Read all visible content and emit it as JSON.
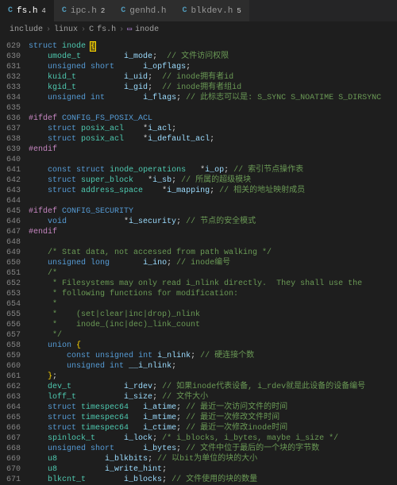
{
  "tabs": [
    {
      "icon": "C",
      "label": "fs.h",
      "mod": "4",
      "active": true
    },
    {
      "icon": "C",
      "label": "ipc.h",
      "mod": "2",
      "active": false
    },
    {
      "icon": "C",
      "label": "genhd.h",
      "mod": "",
      "active": false
    },
    {
      "icon": "C",
      "label": "blkdev.h",
      "mod": "5",
      "active": false
    }
  ],
  "breadcrumb": {
    "parts": [
      "include",
      "linux",
      "fs.h"
    ],
    "symbol": "inode"
  },
  "lines": [
    {
      "n": "",
      "tokens": []
    },
    {
      "n": "629",
      "tokens": [
        [
          "kw",
          "struct"
        ],
        [
          "plain",
          " "
        ],
        [
          "typename",
          "inode"
        ],
        [
          "plain",
          " "
        ],
        [
          "punc cursor",
          "{"
        ]
      ]
    },
    {
      "n": "630",
      "tokens": [
        [
          "plain",
          "    "
        ],
        [
          "typename",
          "umode_t"
        ],
        [
          "plain",
          "         "
        ],
        [
          "ident",
          "i_mode"
        ],
        [
          "plain",
          ";  "
        ],
        [
          "comment",
          "// 文件访问权限"
        ]
      ]
    },
    {
      "n": "631",
      "tokens": [
        [
          "plain",
          "    "
        ],
        [
          "kw",
          "unsigned"
        ],
        [
          "plain",
          " "
        ],
        [
          "kw",
          "short"
        ],
        [
          "plain",
          "      "
        ],
        [
          "ident",
          "i_opflags"
        ],
        [
          "plain",
          ";"
        ]
      ]
    },
    {
      "n": "632",
      "tokens": [
        [
          "plain",
          "    "
        ],
        [
          "typename",
          "kuid_t"
        ],
        [
          "plain",
          "          "
        ],
        [
          "ident",
          "i_uid"
        ],
        [
          "plain",
          ";  "
        ],
        [
          "comment",
          "// inode拥有者id"
        ]
      ]
    },
    {
      "n": "633",
      "tokens": [
        [
          "plain",
          "    "
        ],
        [
          "typename",
          "kgid_t"
        ],
        [
          "plain",
          "          "
        ],
        [
          "ident",
          "i_gid"
        ],
        [
          "plain",
          ";  "
        ],
        [
          "comment",
          "// inode拥有者组id"
        ]
      ]
    },
    {
      "n": "634",
      "tokens": [
        [
          "plain",
          "    "
        ],
        [
          "kw",
          "unsigned"
        ],
        [
          "plain",
          " "
        ],
        [
          "kw",
          "int"
        ],
        [
          "plain",
          "        "
        ],
        [
          "ident",
          "i_flags"
        ],
        [
          "plain",
          "; "
        ],
        [
          "comment",
          "// 此标志可以是: S_SYNC S_NOATIME S_DIRSYNC"
        ]
      ]
    },
    {
      "n": "635",
      "tokens": []
    },
    {
      "n": "636",
      "tokens": [
        [
          "macro",
          "#ifdef"
        ],
        [
          "plain",
          " "
        ],
        [
          "define",
          "CONFIG_FS_POSIX_ACL"
        ]
      ]
    },
    {
      "n": "637",
      "tokens": [
        [
          "plain",
          "    "
        ],
        [
          "kw",
          "struct"
        ],
        [
          "plain",
          " "
        ],
        [
          "typename",
          "posix_acl"
        ],
        [
          "plain",
          "    *"
        ],
        [
          "ident",
          "i_acl"
        ],
        [
          "plain",
          ";"
        ]
      ]
    },
    {
      "n": "638",
      "tokens": [
        [
          "plain",
          "    "
        ],
        [
          "kw",
          "struct"
        ],
        [
          "plain",
          " "
        ],
        [
          "typename",
          "posix_acl"
        ],
        [
          "plain",
          "    *"
        ],
        [
          "ident",
          "i_default_acl"
        ],
        [
          "plain",
          ";"
        ]
      ]
    },
    {
      "n": "639",
      "tokens": [
        [
          "macro",
          "#endif"
        ]
      ]
    },
    {
      "n": "640",
      "tokens": []
    },
    {
      "n": "641",
      "tokens": [
        [
          "plain",
          "    "
        ],
        [
          "kw",
          "const"
        ],
        [
          "plain",
          " "
        ],
        [
          "kw",
          "struct"
        ],
        [
          "plain",
          " "
        ],
        [
          "typename",
          "inode_operations"
        ],
        [
          "plain",
          "   *"
        ],
        [
          "ident",
          "i_op"
        ],
        [
          "plain",
          "; "
        ],
        [
          "comment",
          "// 索引节点操作表"
        ]
      ]
    },
    {
      "n": "642",
      "tokens": [
        [
          "plain",
          "    "
        ],
        [
          "kw",
          "struct"
        ],
        [
          "plain",
          " "
        ],
        [
          "typename",
          "super_block"
        ],
        [
          "plain",
          "   *"
        ],
        [
          "ident",
          "i_sb"
        ],
        [
          "plain",
          "; "
        ],
        [
          "comment",
          "// 所属的超级模块"
        ]
      ]
    },
    {
      "n": "643",
      "tokens": [
        [
          "plain",
          "    "
        ],
        [
          "kw",
          "struct"
        ],
        [
          "plain",
          " "
        ],
        [
          "typename",
          "address_space"
        ],
        [
          "plain",
          "    *"
        ],
        [
          "ident",
          "i_mapping"
        ],
        [
          "plain",
          "; "
        ],
        [
          "comment",
          "// 相关的地址映射成员"
        ]
      ]
    },
    {
      "n": "644",
      "tokens": []
    },
    {
      "n": "645",
      "tokens": [
        [
          "macro",
          "#ifdef"
        ],
        [
          "plain",
          " "
        ],
        [
          "define",
          "CONFIG_SECURITY"
        ]
      ]
    },
    {
      "n": "646",
      "tokens": [
        [
          "plain",
          "    "
        ],
        [
          "kw",
          "void"
        ],
        [
          "plain",
          "            *"
        ],
        [
          "ident",
          "i_security"
        ],
        [
          "plain",
          "; "
        ],
        [
          "comment",
          "// 节点的安全模式"
        ]
      ]
    },
    {
      "n": "647",
      "tokens": [
        [
          "macro",
          "#endif"
        ]
      ]
    },
    {
      "n": "648",
      "tokens": []
    },
    {
      "n": "649",
      "tokens": [
        [
          "plain",
          "    "
        ],
        [
          "comment",
          "/* Stat data, not accessed from path walking */"
        ]
      ]
    },
    {
      "n": "650",
      "tokens": [
        [
          "plain",
          "    "
        ],
        [
          "kw",
          "unsigned"
        ],
        [
          "plain",
          " "
        ],
        [
          "kw",
          "long"
        ],
        [
          "plain",
          "       "
        ],
        [
          "ident",
          "i_ino"
        ],
        [
          "plain",
          "; "
        ],
        [
          "comment",
          "// inode编号"
        ]
      ]
    },
    {
      "n": "651",
      "tokens": [
        [
          "plain",
          "    "
        ],
        [
          "comment",
          "/*"
        ]
      ]
    },
    {
      "n": "652",
      "tokens": [
        [
          "plain",
          "    "
        ],
        [
          "comment",
          " * Filesystems may only read i_nlink directly.  They shall use the"
        ]
      ]
    },
    {
      "n": "653",
      "tokens": [
        [
          "plain",
          "    "
        ],
        [
          "comment",
          " * following functions for modification:"
        ]
      ]
    },
    {
      "n": "654",
      "tokens": [
        [
          "plain",
          "    "
        ],
        [
          "comment",
          " *"
        ]
      ]
    },
    {
      "n": "655",
      "tokens": [
        [
          "plain",
          "    "
        ],
        [
          "comment",
          " *    (set|clear|inc|drop)_nlink"
        ]
      ]
    },
    {
      "n": "656",
      "tokens": [
        [
          "plain",
          "    "
        ],
        [
          "comment",
          " *    inode_(inc|dec)_link_count"
        ]
      ]
    },
    {
      "n": "657",
      "tokens": [
        [
          "plain",
          "    "
        ],
        [
          "comment",
          " */"
        ]
      ]
    },
    {
      "n": "658",
      "tokens": [
        [
          "plain",
          "    "
        ],
        [
          "kw",
          "union"
        ],
        [
          "plain",
          " "
        ],
        [
          "punc",
          "{"
        ]
      ]
    },
    {
      "n": "659",
      "tokens": [
        [
          "plain",
          "        "
        ],
        [
          "kw",
          "const"
        ],
        [
          "plain",
          " "
        ],
        [
          "kw",
          "unsigned"
        ],
        [
          "plain",
          " "
        ],
        [
          "kw",
          "int"
        ],
        [
          "plain",
          " "
        ],
        [
          "ident",
          "i_nlink"
        ],
        [
          "plain",
          "; "
        ],
        [
          "comment",
          "// 硬连接个数"
        ]
      ]
    },
    {
      "n": "660",
      "tokens": [
        [
          "plain",
          "        "
        ],
        [
          "kw",
          "unsigned"
        ],
        [
          "plain",
          " "
        ],
        [
          "kw",
          "int"
        ],
        [
          "plain",
          " "
        ],
        [
          "ident",
          "__i_nlink"
        ],
        [
          "plain",
          ";"
        ]
      ]
    },
    {
      "n": "661",
      "tokens": [
        [
          "plain",
          "    "
        ],
        [
          "punc",
          "}"
        ],
        [
          "plain",
          ";"
        ]
      ]
    },
    {
      "n": "662",
      "tokens": [
        [
          "plain",
          "    "
        ],
        [
          "typename",
          "dev_t"
        ],
        [
          "plain",
          "           "
        ],
        [
          "ident",
          "i_rdev"
        ],
        [
          "plain",
          "; "
        ],
        [
          "comment",
          "// 如果inode代表设备, i_rdev就是此设备的设备编号"
        ]
      ]
    },
    {
      "n": "663",
      "tokens": [
        [
          "plain",
          "    "
        ],
        [
          "typename",
          "loff_t"
        ],
        [
          "plain",
          "          "
        ],
        [
          "ident",
          "i_size"
        ],
        [
          "plain",
          "; "
        ],
        [
          "comment",
          "// 文件大小"
        ]
      ]
    },
    {
      "n": "664",
      "tokens": [
        [
          "plain",
          "    "
        ],
        [
          "kw",
          "struct"
        ],
        [
          "plain",
          " "
        ],
        [
          "typename",
          "timespec64"
        ],
        [
          "plain",
          "   "
        ],
        [
          "ident",
          "i_atime"
        ],
        [
          "plain",
          "; "
        ],
        [
          "comment",
          "// 最近一次访问文件的时间"
        ]
      ]
    },
    {
      "n": "665",
      "tokens": [
        [
          "plain",
          "    "
        ],
        [
          "kw",
          "struct"
        ],
        [
          "plain",
          " "
        ],
        [
          "typename",
          "timespec64"
        ],
        [
          "plain",
          "   "
        ],
        [
          "ident",
          "i_mtime"
        ],
        [
          "plain",
          "; "
        ],
        [
          "comment",
          "// 最近一次修改文件时间"
        ]
      ]
    },
    {
      "n": "666",
      "tokens": [
        [
          "plain",
          "    "
        ],
        [
          "kw",
          "struct"
        ],
        [
          "plain",
          " "
        ],
        [
          "typename",
          "timespec64"
        ],
        [
          "plain",
          "   "
        ],
        [
          "ident",
          "i_ctime"
        ],
        [
          "plain",
          "; "
        ],
        [
          "comment",
          "// 最近一次修改inode时间"
        ]
      ]
    },
    {
      "n": "667",
      "tokens": [
        [
          "plain",
          "    "
        ],
        [
          "typename",
          "spinlock_t"
        ],
        [
          "plain",
          "      "
        ],
        [
          "ident",
          "i_lock"
        ],
        [
          "plain",
          "; "
        ],
        [
          "comment",
          "/* i_blocks, i_bytes, maybe i_size */"
        ]
      ]
    },
    {
      "n": "668",
      "tokens": [
        [
          "plain",
          "    "
        ],
        [
          "kw",
          "unsigned"
        ],
        [
          "plain",
          " "
        ],
        [
          "kw",
          "short"
        ],
        [
          "plain",
          "      "
        ],
        [
          "ident",
          "i_bytes"
        ],
        [
          "plain",
          "; "
        ],
        [
          "comment",
          "// 文件中位于最后的一个块的字节数"
        ]
      ]
    },
    {
      "n": "669",
      "tokens": [
        [
          "plain",
          "    "
        ],
        [
          "typename",
          "u8"
        ],
        [
          "plain",
          "          "
        ],
        [
          "ident",
          "i_blkbits"
        ],
        [
          "plain",
          "; "
        ],
        [
          "comment",
          "// 以bit为单位的块的大小"
        ]
      ]
    },
    {
      "n": "670",
      "tokens": [
        [
          "plain",
          "    "
        ],
        [
          "typename",
          "u8"
        ],
        [
          "plain",
          "          "
        ],
        [
          "ident",
          "i_write_hint"
        ],
        [
          "plain",
          ";"
        ]
      ]
    },
    {
      "n": "671",
      "tokens": [
        [
          "plain",
          "    "
        ],
        [
          "typename",
          "blkcnt_t"
        ],
        [
          "plain",
          "        "
        ],
        [
          "ident",
          "i_blocks"
        ],
        [
          "plain",
          "; "
        ],
        [
          "comment",
          "// 文件使用的块的数量"
        ]
      ]
    }
  ]
}
